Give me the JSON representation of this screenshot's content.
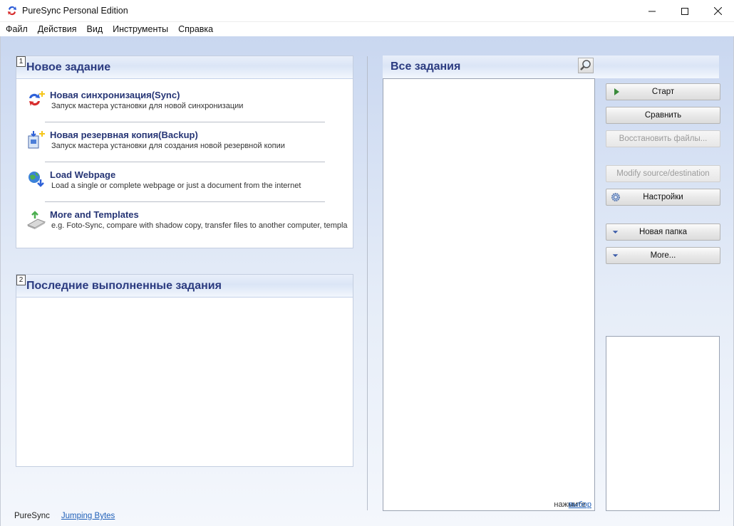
{
  "window": {
    "title": "PureSync Personal Edition"
  },
  "menu": [
    "Файл",
    "Действия",
    "Вид",
    "Инструменты",
    "Справка"
  ],
  "new_task_panel": {
    "number": "1",
    "title": "Новое задание",
    "items": [
      {
        "title": "Новая синхронизация(Sync)",
        "desc": "Запуск мастера установки для новой синхронизации",
        "icon": "sync-icon"
      },
      {
        "title": "Новая резервная копия(Backup)",
        "desc": "Запуск мастера установки для создания новой резервной копии",
        "icon": "backup-icon"
      },
      {
        "title": "Load Webpage",
        "desc": "Load a single or complete webpage or just a document from the internet",
        "icon": "globe-download-icon"
      },
      {
        "title": "More and Templates",
        "desc": "e.g. Foto-Sync, compare with shadow copy, transfer files to another computer, templa",
        "icon": "templates-icon"
      }
    ]
  },
  "recent_panel": {
    "number": "2",
    "title": "Последние выполненные задания"
  },
  "all_jobs": {
    "title": "Все задания",
    "hint_text": "нажмите",
    "hint_link": "выбор"
  },
  "buttons": {
    "start": "Старт",
    "compare": "Сравнить",
    "restore": "Восстановить файлы...",
    "modify": "Modify source/destination",
    "settings": "Настройки",
    "new_folder": "Новая папка",
    "more": "More..."
  },
  "footer": {
    "app": "PureSync",
    "link": "Jumping Bytes"
  },
  "colors": {
    "accent_title": "#2b3b80",
    "link": "#1f5fb8",
    "background_gradient_top": "#c9d7f0"
  }
}
